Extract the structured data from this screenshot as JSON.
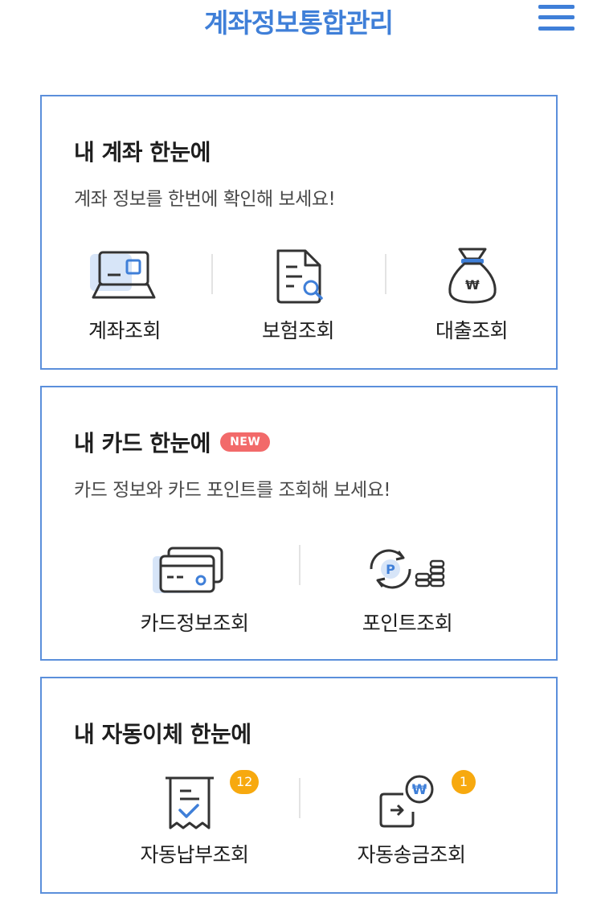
{
  "header": {
    "title": "계좌정보통합관리"
  },
  "account_card": {
    "title": "내 계좌 한눈에",
    "desc": "계좌 정보를 한번에 확인해 보세요!",
    "items": [
      {
        "label": "계좌조회",
        "icon": "laptop-icon"
      },
      {
        "label": "보험조회",
        "icon": "document-search-icon"
      },
      {
        "label": "대출조회",
        "icon": "money-bag-icon"
      }
    ]
  },
  "card_card": {
    "title": "내 카드 한눈에",
    "badge": "NEW",
    "desc": "카드 정보와 카드 포인트를 조회해 보세요!",
    "items": [
      {
        "label": "카드정보조회",
        "icon": "credit-card-icon"
      },
      {
        "label": "포인트조회",
        "icon": "point-coins-icon"
      }
    ]
  },
  "autotransfer_card": {
    "title": "내 자동이체 한눈에",
    "items": [
      {
        "label": "자동납부조회",
        "icon": "receipt-check-icon",
        "count": "12"
      },
      {
        "label": "자동송금조회",
        "icon": "won-transfer-icon",
        "count": "1"
      }
    ]
  },
  "colors": {
    "accent": "#3f7fd8",
    "border": "#5b8fdb",
    "new_badge": "#f26a6a",
    "count_badge": "#f7a90f"
  }
}
